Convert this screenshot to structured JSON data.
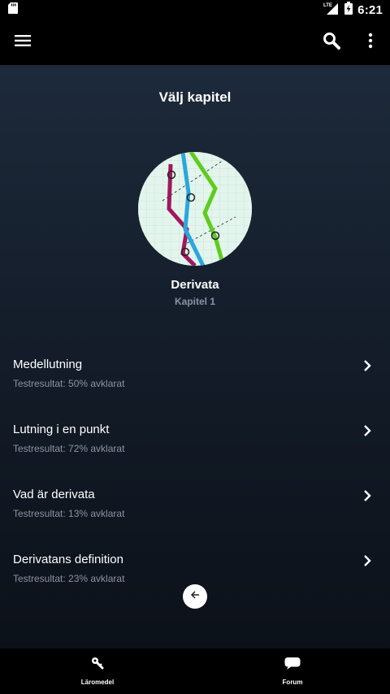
{
  "status_bar": {
    "time": "6:21",
    "network": "LTE",
    "icons": [
      "sd-card-icon",
      "signal-icon",
      "battery-icon"
    ]
  },
  "app_bar": {
    "icons": [
      "menu-icon",
      "search-icon",
      "more-vert-icon"
    ]
  },
  "page": {
    "title": "Välj kapitel"
  },
  "chapter": {
    "name": "Derivata",
    "subtitle": "Kapitel 1",
    "image": "chapter-illustration"
  },
  "sections": [
    {
      "title": "Medellutning",
      "result": "Testresultat: 50% avklarat"
    },
    {
      "title": "Lutning i en punkt",
      "result": "Testresultat: 72% avklarat"
    },
    {
      "title": "Vad är derivata",
      "result": "Testresultat: 13% avklarat"
    },
    {
      "title": "Derivatans definition",
      "result": "Testresultat: 23% avklarat"
    }
  ],
  "back_button": {
    "icon": "arrow-left-icon"
  },
  "bottom_nav": {
    "items": [
      {
        "label": "Läromedel",
        "icon": "key-icon"
      },
      {
        "label": "Forum",
        "icon": "chat-bubble-icon"
      }
    ]
  },
  "colors": {
    "background_top": "#1d2a3b",
    "background_bottom": "#0c1119",
    "bar": "#000000",
    "subtitle": "#8a94a3",
    "line_green": "#5fcc1d",
    "line_blue": "#2aa7dd",
    "line_magenta": "#a0185e"
  }
}
